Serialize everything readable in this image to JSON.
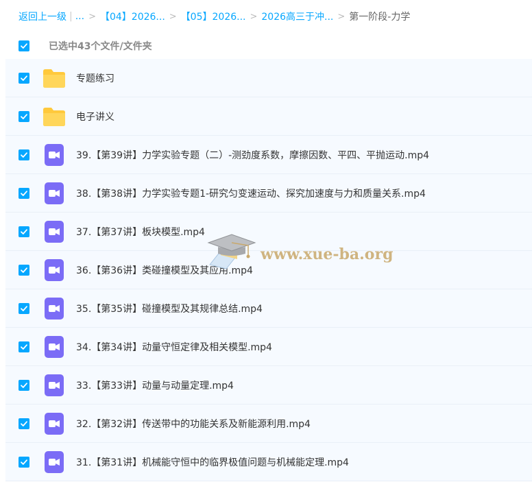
{
  "breadcrumb": {
    "back_label": "返回上一级",
    "ellipsis": "...",
    "crumbs": [
      "【04】2026...",
      "【05】2026...",
      "2026高三于冲..."
    ],
    "current": "第一阶段-力学"
  },
  "selection": {
    "summary": "已选中43个文件/文件夹",
    "all_checked": true
  },
  "files": [
    {
      "type": "folder",
      "name": "专题练习",
      "checked": true
    },
    {
      "type": "folder",
      "name": "电子讲义",
      "checked": true
    },
    {
      "type": "video",
      "name": "39.【第39讲】力学实验专题（二）-测劲度系数，摩擦因数、平四、平抛运动.mp4",
      "checked": true
    },
    {
      "type": "video",
      "name": "38.【第38讲】力学实验专题1-研究匀变速运动、探究加速度与力和质量关系.mp4",
      "checked": true
    },
    {
      "type": "video",
      "name": "37.【第37讲】板块模型.mp4",
      "checked": true
    },
    {
      "type": "video",
      "name": "36.【第36讲】类碰撞模型及其应用.mp4",
      "checked": true
    },
    {
      "type": "video",
      "name": "35.【第35讲】碰撞模型及其规律总结.mp4",
      "checked": true
    },
    {
      "type": "video",
      "name": "34.【第34讲】动量守恒定律及相关模型.mp4",
      "checked": true
    },
    {
      "type": "video",
      "name": "33.【第33讲】动量与动量定理.mp4",
      "checked": true
    },
    {
      "type": "video",
      "name": "32.【第32讲】传送带中的功能关系及新能源利用.mp4",
      "checked": true
    },
    {
      "type": "video",
      "name": "31.【第31讲】机械能守恒中的临界极值问题与机械能定理.mp4",
      "checked": true
    }
  ],
  "watermark": {
    "text": "www.xue-ba.org"
  },
  "colors": {
    "accent": "#06a7ff",
    "folder": "#ffc93c",
    "video_icon": "#7b6cf6",
    "row_bg": "#f6faff"
  },
  "icons": {
    "checkbox": "check-icon",
    "folder": "folder-icon",
    "video": "video-file-icon",
    "watermark": "graduation-cap-icon"
  }
}
